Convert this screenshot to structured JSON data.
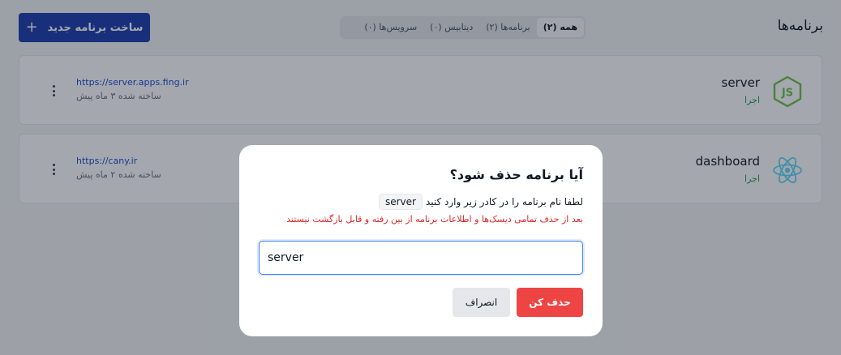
{
  "header": {
    "title": "برنامه‌ها",
    "new_app_label": "ساخت برنامه جدید",
    "new_app_icon": "plus-icon",
    "filters": [
      {
        "label": "همه (۲)",
        "active": true
      },
      {
        "label": "برنامه‌ها (۲)",
        "active": false
      },
      {
        "label": "دیتابیس (۰)",
        "active": false
      },
      {
        "label": "سرویس‌ها (۰)",
        "active": false
      }
    ]
  },
  "apps": [
    {
      "name": "server",
      "status": "اجرا",
      "url": "https://server.apps.fing.ir",
      "created": "ساخته شده ۳ ماه پیش",
      "icon": "nodejs-icon"
    },
    {
      "name": "dashboard",
      "status": "اجرا",
      "url": "https://cany.ir",
      "created": "ساخته شده ۲ ماه پیش",
      "icon": "react-icon"
    }
  ],
  "modal": {
    "title": "آیا برنامه حذف شود؟",
    "instruction": "لطفا نام برنامه را در کادر زیر وارد کنید",
    "app_name_code": "server",
    "warning": "بعد از حذف تمامی دیسک‌ها و اطلاعات برنامه از بین رفته و قابل بازگشت نیستند",
    "input_value": "server",
    "delete_label": "حذف کن",
    "cancel_label": "انصراف"
  },
  "colors": {
    "primary": "#1e40af",
    "danger": "#ef4444",
    "success": "#16a34a",
    "link": "#1d4ed8",
    "nodejs": "#6cc24a",
    "react": "#61dafb"
  }
}
